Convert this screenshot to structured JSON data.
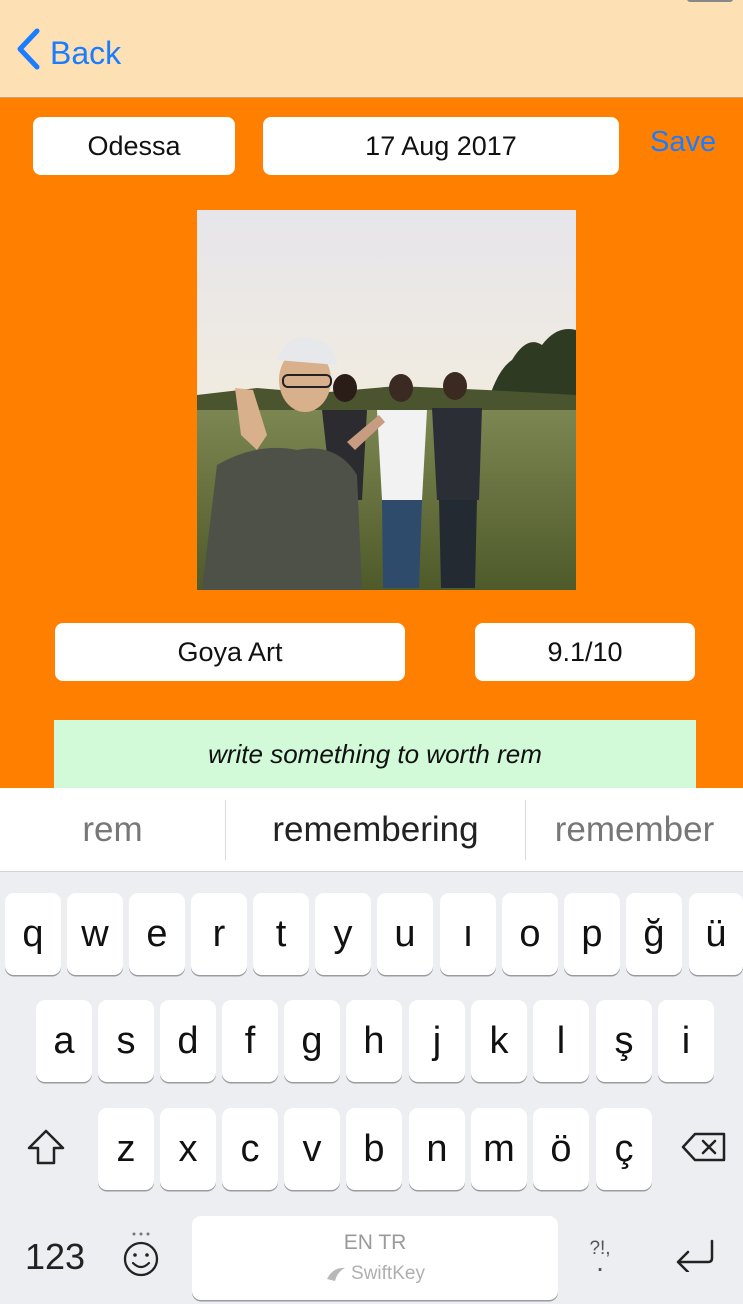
{
  "nav": {
    "back_label": "Back"
  },
  "form": {
    "city": "Odessa",
    "date": "17 Aug 2017",
    "save_label": "Save",
    "place": "Goya Art",
    "rating": "9.1/10",
    "note_text": "write something to worth rem"
  },
  "suggestions": [
    "rem",
    "remembering",
    "remember"
  ],
  "keyboard": {
    "row1": [
      "q",
      "w",
      "e",
      "r",
      "t",
      "y",
      "u",
      "ı",
      "o",
      "p",
      "ğ",
      "ü"
    ],
    "row2": [
      "a",
      "s",
      "d",
      "f",
      "g",
      "h",
      "j",
      "k",
      "l",
      "ş",
      "i"
    ],
    "row3": [
      "z",
      "x",
      "c",
      "v",
      "b",
      "n",
      "m",
      "ö",
      "ç"
    ],
    "numbers_label": "123",
    "space_languages": "EN TR",
    "space_brand": "SwiftKey",
    "punct_label": "?!,",
    "punct_dot": "·"
  }
}
